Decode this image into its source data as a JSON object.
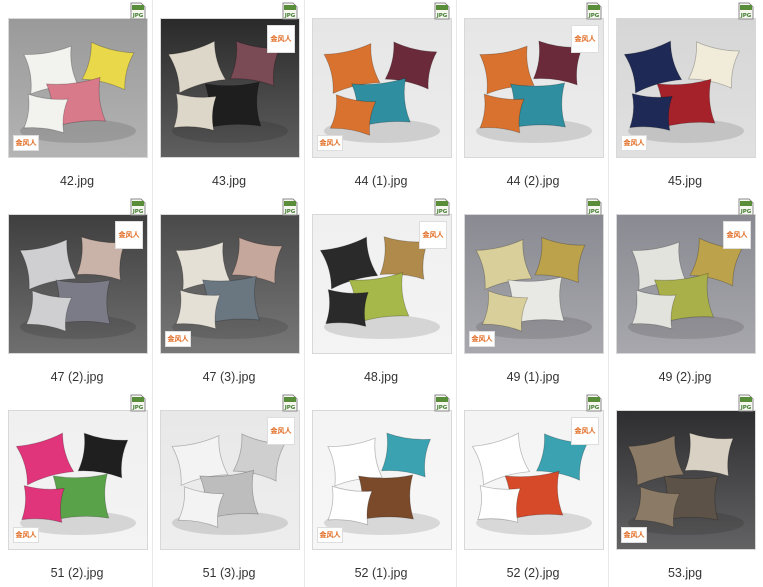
{
  "window": {
    "view": "large-icons"
  },
  "badge": {
    "label": "JPG",
    "color": "#3c7a2a"
  },
  "brand": {
    "text": "金风人"
  },
  "files": [
    {
      "name": "42.jpg",
      "icon": "pillow-thumbnail",
      "palette": [
        "#9a9a9a",
        "#f2f2ee",
        "#e8d84a",
        "#d97a8a"
      ]
    },
    {
      "name": "43.jpg",
      "icon": "pillow-thumbnail",
      "palette": [
        "#2a2a2a",
        "#ddd7c9",
        "#7a4a55",
        "#1e1e1e"
      ]
    },
    {
      "name": "44 (1).jpg",
      "icon": "pillow-thumbnail",
      "palette": [
        "#e6e6e6",
        "#d9722e",
        "#6b2a3a",
        "#2f8ea0"
      ]
    },
    {
      "name": "44 (2).jpg",
      "icon": "pillow-thumbnail",
      "palette": [
        "#e6e6e6",
        "#d9722e",
        "#6b2a3a",
        "#2f8ea0"
      ]
    },
    {
      "name": "45.jpg",
      "icon": "pillow-thumbnail",
      "palette": [
        "#d6d6d6",
        "#1e2a55",
        "#f1ecd9",
        "#a5222a"
      ]
    },
    {
      "name": "47 (2).jpg",
      "icon": "pillow-thumbnail",
      "palette": [
        "#3f3f3f",
        "#cfcfd2",
        "#c9b2a8",
        "#7a7b86"
      ]
    },
    {
      "name": "47 (3).jpg",
      "icon": "pillow-thumbnail",
      "palette": [
        "#4a4a4a",
        "#e5e0d6",
        "#c6a79b",
        "#6a7680"
      ]
    },
    {
      "name": "48.jpg",
      "icon": "pillow-thumbnail",
      "palette": [
        "#f0f0f0",
        "#2a2a2a",
        "#b08a4a",
        "#a6b84a"
      ]
    },
    {
      "name": "49 (1).jpg",
      "icon": "pillow-thumbnail",
      "palette": [
        "#8a8a92",
        "#d8cf9a",
        "#bca24a",
        "#e8e8e4"
      ]
    },
    {
      "name": "49 (2).jpg",
      "icon": "pillow-thumbnail",
      "palette": [
        "#8a8a92",
        "#e3e3de",
        "#bca24a",
        "#a9b04a"
      ]
    },
    {
      "name": "51 (2).jpg",
      "icon": "pillow-thumbnail",
      "palette": [
        "#f0f0f0",
        "#e0357a",
        "#1f1f1f",
        "#5aa24a"
      ]
    },
    {
      "name": "51 (3).jpg",
      "icon": "pillow-thumbnail",
      "palette": [
        "#e8e8e8",
        "#f3f3f3",
        "#cfcfcf",
        "#bdbdbd"
      ]
    },
    {
      "name": "52 (1).jpg",
      "icon": "pillow-thumbnail",
      "palette": [
        "#f4f4f4",
        "#ffffff",
        "#3aa2b0",
        "#7a4a2a"
      ]
    },
    {
      "name": "52 (2).jpg",
      "icon": "pillow-thumbnail",
      "palette": [
        "#f4f4f4",
        "#ffffff",
        "#3aa2b0",
        "#d64a2a"
      ]
    },
    {
      "name": "53.jpg",
      "icon": "pillow-thumbnail",
      "palette": [
        "#2e2e30",
        "#8a7a66",
        "#d9d2c4",
        "#5c5248"
      ]
    }
  ]
}
